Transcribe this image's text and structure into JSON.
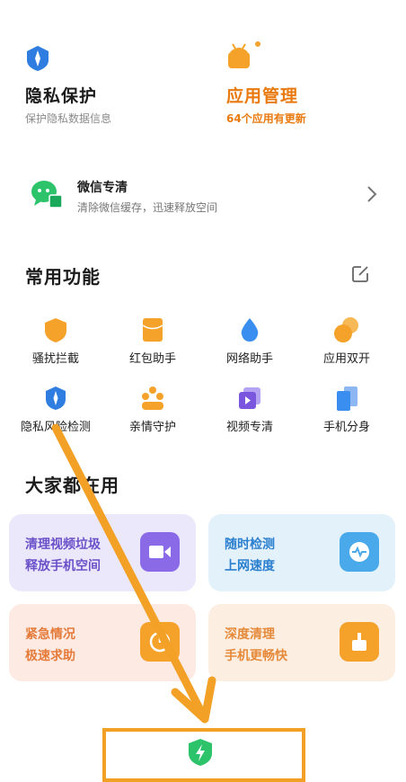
{
  "top_cards": {
    "privacy": {
      "title": "隐私保护",
      "subtitle": "保护隐私数据信息"
    },
    "apps": {
      "title": "应用管理",
      "subtitle": "64个应用有更新"
    }
  },
  "wechat": {
    "title": "微信专清",
    "subtitle": "清除微信缓存，迅速释放空间"
  },
  "common": {
    "title": "常用功能",
    "items": [
      {
        "label": "骚扰拦截"
      },
      {
        "label": "红包助手"
      },
      {
        "label": "网络助手"
      },
      {
        "label": "应用双开"
      },
      {
        "label": "隐私风险检测"
      },
      {
        "label": "亲情守护"
      },
      {
        "label": "视频专清"
      },
      {
        "label": "手机分身"
      }
    ]
  },
  "popular": {
    "title": "大家都在用",
    "cards": [
      {
        "line1": "清理视频垃圾",
        "line2": "释放手机空间"
      },
      {
        "line1": "随时检测",
        "line2": "上网速度"
      },
      {
        "line1": "紧急情况",
        "line2": "极速求助"
      },
      {
        "line1": "深度清理",
        "line2": "手机更畅快"
      }
    ]
  },
  "colors": {
    "orange": "#f5a22a",
    "blue": "#3a8ef0",
    "purple": "#8a6ae6",
    "green": "#2cc36b",
    "annotation": "#f2a126"
  }
}
